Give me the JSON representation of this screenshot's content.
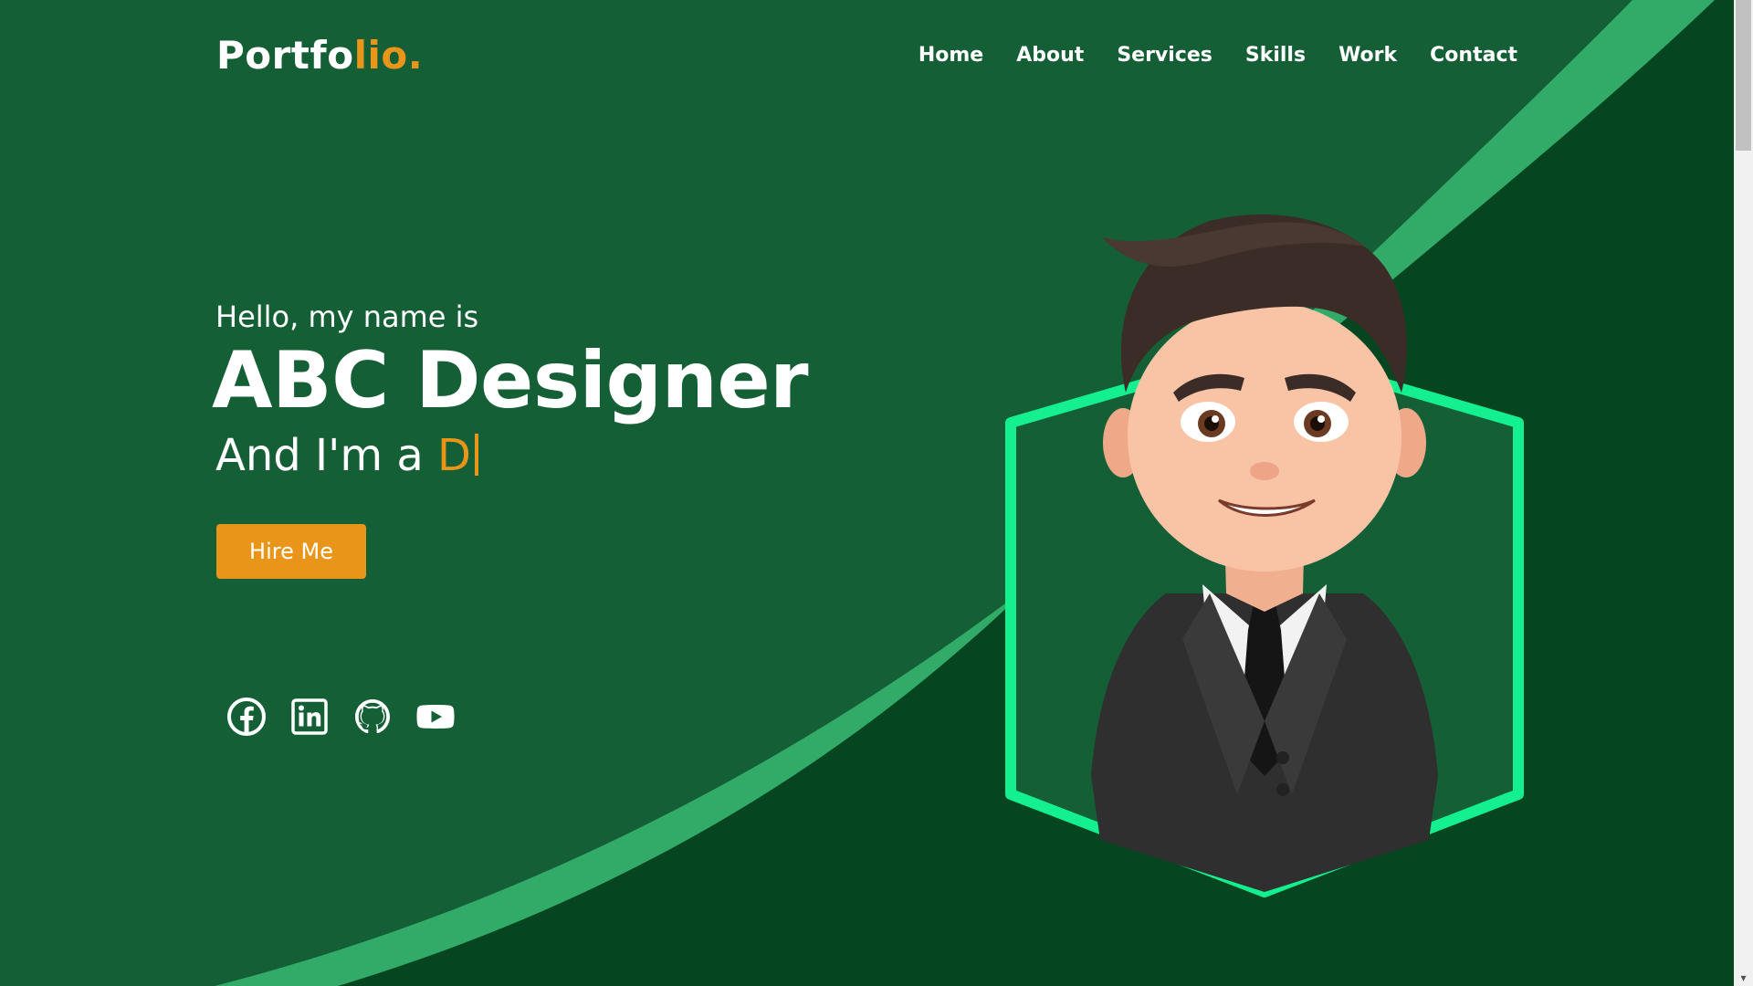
{
  "header": {
    "logo_main": "Portfo",
    "logo_accent": "lio."
  },
  "nav": {
    "items": [
      {
        "label": "Home"
      },
      {
        "label": "About"
      },
      {
        "label": "Services"
      },
      {
        "label": "Skills"
      },
      {
        "label": "Work"
      },
      {
        "label": "Contact"
      }
    ]
  },
  "hero": {
    "greeting": "Hello, my name is",
    "name": "ABC Designer",
    "role_prefix": "And I'm a ",
    "role_typed": "D",
    "hire_button_label": "Hire Me"
  },
  "socials": [
    {
      "icon": "facebook-icon"
    },
    {
      "icon": "linkedin-icon"
    },
    {
      "icon": "github-icon"
    },
    {
      "icon": "youtube-icon"
    }
  ],
  "colors": {
    "background": "#145f36",
    "background_dark": "#054520",
    "stripe": "#33ab68",
    "accent": "#e8951a",
    "hexagon_border": "#14f08f",
    "text": "#ffffff"
  }
}
